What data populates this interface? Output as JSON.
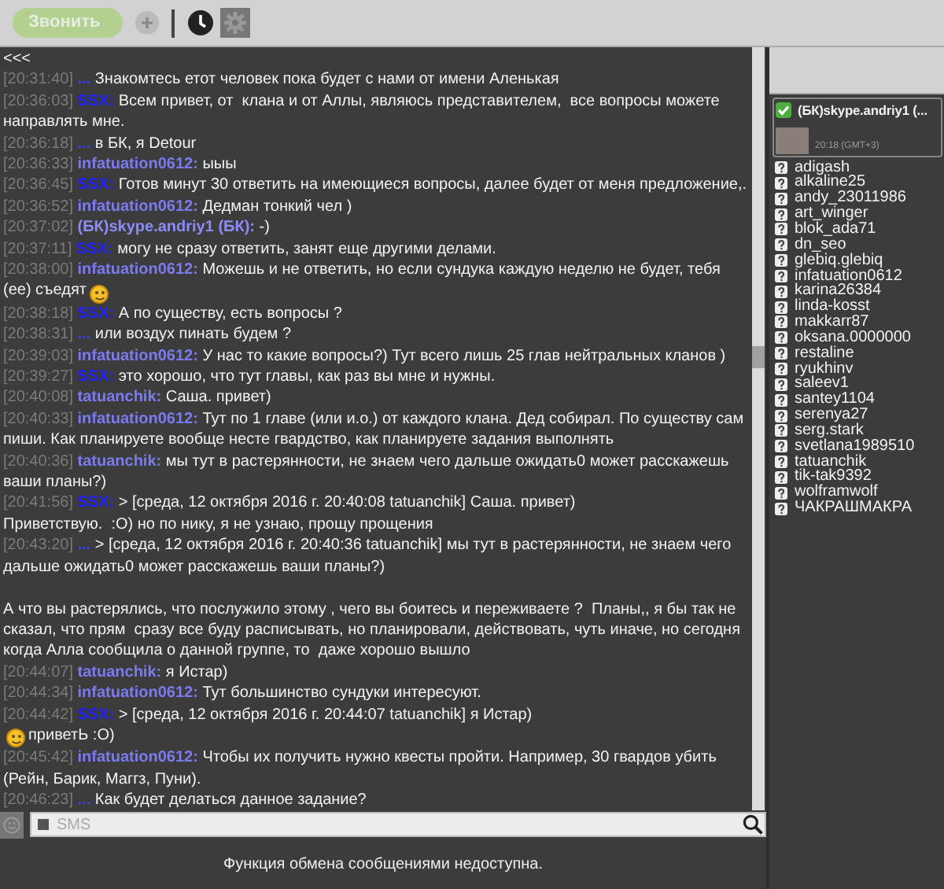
{
  "toolbar": {
    "call_button": {
      "label": "Звонить",
      "disabled": true
    }
  },
  "chat": {
    "history_link": "<<<",
    "messages": [
      {
        "time": "[20:31:40]",
        "author": "...",
        "color": "#3a3aff",
        "body": [
          {
            "kind": "text",
            "text": "Знакомтесь етот человек пока будет с нами от имени Аленькая"
          }
        ]
      },
      {
        "time": "[20:36:03]",
        "author": "SSX:",
        "color": "#2020ff",
        "body": [
          {
            "kind": "text",
            "text": "Всем привет, от  клана и от Аллы, являюсь представителем,  все вопросы можете направлять мне."
          }
        ]
      },
      {
        "time": "[20:36:18]",
        "author": "...",
        "color": "#3a3aff",
        "body": [
          {
            "kind": "text",
            "text": "в БК, я Detour"
          }
        ]
      },
      {
        "time": "[20:36:33]",
        "author": "infatuation0612:",
        "color": "#7b7bef",
        "body": [
          {
            "kind": "text",
            "text": "ыыы"
          }
        ]
      },
      {
        "time": "[20:36:45]",
        "author": "SSX:",
        "color": "#2020ff",
        "body": [
          {
            "kind": "text",
            "text": "Готов минут 30 ответить на имеющиеся вопросы, далее будет от меня предложение,."
          }
        ]
      },
      {
        "time": "[20:36:52]",
        "author": "infatuation0612:",
        "color": "#7b7bef",
        "body": [
          {
            "kind": "text",
            "text": "Дедман тонкий чел )"
          }
        ]
      },
      {
        "time": "[20:37:02]",
        "author": "(БК)skype.andriy1 (БК):",
        "color": "#8c8cff",
        "body": [
          {
            "kind": "text",
            "text": "-)"
          }
        ]
      },
      {
        "time": "[20:37:11]",
        "author": "SSX:",
        "color": "#2020ff",
        "body": [
          {
            "kind": "text",
            "text": "могу не сразу ответить, занят еще другими делами."
          }
        ]
      },
      {
        "time": "[20:38:00]",
        "author": "infatuation0612:",
        "color": "#7b7bef",
        "body": [
          {
            "kind": "text",
            "text": "Можешь и не ответить, но если сундука каждую неделю не будет, тебя (ее) съедят"
          },
          {
            "kind": "smiley"
          }
        ]
      },
      {
        "time": "[20:38:18]",
        "author": "SSX:",
        "color": "#2020ff",
        "body": [
          {
            "kind": "text",
            "text": "А по существу, есть вопросы ?"
          }
        ]
      },
      {
        "time": "[20:38:31]",
        "author": "...",
        "color": "#3a3aff",
        "body": [
          {
            "kind": "text",
            "text": "или воздух пинать будем ?"
          }
        ]
      },
      {
        "time": "[20:39:03]",
        "author": "infatuation0612:",
        "color": "#7b7bef",
        "body": [
          {
            "kind": "text",
            "text": "У нас то какие вопросы?) Тут всего лишь 25 глав нейтральных кланов )"
          }
        ]
      },
      {
        "time": "[20:39:27]",
        "author": "SSX:",
        "color": "#2020ff",
        "body": [
          {
            "kind": "text",
            "text": "это хорошо, что тут главы, как раз вы мне и нужны."
          }
        ]
      },
      {
        "time": "[20:40:08]",
        "author": "tatuanchik:",
        "color": "#7b7bef",
        "body": [
          {
            "kind": "text",
            "text": "Саша. привет)"
          }
        ]
      },
      {
        "time": "[20:40:33]",
        "author": "infatuation0612:",
        "color": "#7b7bef",
        "body": [
          {
            "kind": "text",
            "text": "Тут по 1 главе (или и.о.) от каждого клана. Дед собирал. По существу сам пиши. Как планируете вообще несте гвардство, как планируете задания выполнять"
          }
        ]
      },
      {
        "time": "[20:40:36]",
        "author": "tatuanchik:",
        "color": "#7b7bef",
        "body": [
          {
            "kind": "text",
            "text": "мы тут в растерянности, не знаем чего дальше ожидать0 может расскажешь ваши планы?)"
          }
        ]
      },
      {
        "time": "[20:41:56]",
        "author": "SSX:",
        "color": "#2020ff",
        "body": [
          {
            "kind": "text",
            "text": "> [среда, 12 октября 2016 г. 20:40:08 tatuanchik] Саша. привет)\nПриветствую.  :O) но по нику, я не узнаю, прощу прощения"
          }
        ]
      },
      {
        "time": "[20:43:20]",
        "author": "...",
        "color": "#3a3aff",
        "body": [
          {
            "kind": "text",
            "text": "> [среда, 12 октября 2016 г. 20:40:36 tatuanchik] мы тут в растерянности, не знаем чего дальше ожидать0 может расскажешь ваши планы?)\n\nА что вы растерялись, что послужило этому , чего вы боитесь и переживаете ?  Планы,, я бы так не сказал, что прям  сразу все буду расписывать, но планировали, действовать, чуть иначе, но сегодня когда Алла сообщила о данной группе, то  даже хорошо вышло"
          }
        ]
      },
      {
        "time": "[20:44:07]",
        "author": "tatuanchik:",
        "color": "#7b7bef",
        "body": [
          {
            "kind": "text",
            "text": "я Истар)"
          }
        ]
      },
      {
        "time": "[20:44:34]",
        "author": "infatuation0612:",
        "color": "#7b7bef",
        "body": [
          {
            "kind": "text",
            "text": "Тут большинство сундуки интересуют."
          }
        ]
      },
      {
        "time": "[20:44:42]",
        "author": "SSX:",
        "color": "#2020ff",
        "body": [
          {
            "kind": "text",
            "text": "> [среда, 12 октября 2016 г. 20:44:07 tatuanchik] я Истар)"
          },
          {
            "kind": "break"
          },
          {
            "kind": "smiley"
          },
          {
            "kind": "text",
            "text": "приветЬ :O)"
          }
        ]
      },
      {
        "time": "[20:45:42]",
        "author": "infatuation0612:",
        "color": "#7b7bef",
        "body": [
          {
            "kind": "text",
            "text": "Чтобы их получить нужно квесты пройти. Например, 30 гвардов убить (Рейн, Барик, Маггз, Пуни)."
          }
        ]
      },
      {
        "time": "[20:46:23]",
        "author": "...",
        "color": "#3a3aff",
        "body": [
          {
            "kind": "text",
            "text": "Как будет делаться данное задание?"
          }
        ]
      }
    ]
  },
  "input": {
    "placeholder": "SMS"
  },
  "status_message": "Функция обмена сообщениями недоступна.",
  "contact_panel": {
    "current": {
      "name": "(БК)skype.andriy1 (...",
      "online": true,
      "local_time": "20:18 (GMT+3)"
    },
    "contacts": [
      "adigash",
      "alkaline25",
      "andy_23011986",
      "art_winger",
      "blok_ada71",
      "dn_seo",
      "glebiq.glebiq",
      "infatuation0612",
      "karina26384",
      "linda-kosst",
      "makkarr87",
      "oksana.0000000",
      "restaline",
      "ryukhinv",
      "saleev1",
      "santey1104",
      "serenya27",
      "serg.stark",
      "svetlana1989510",
      "tatuanchik",
      "tik-tak9392",
      "wolframwolf",
      "ЧАКРАШМАКРА"
    ]
  }
}
